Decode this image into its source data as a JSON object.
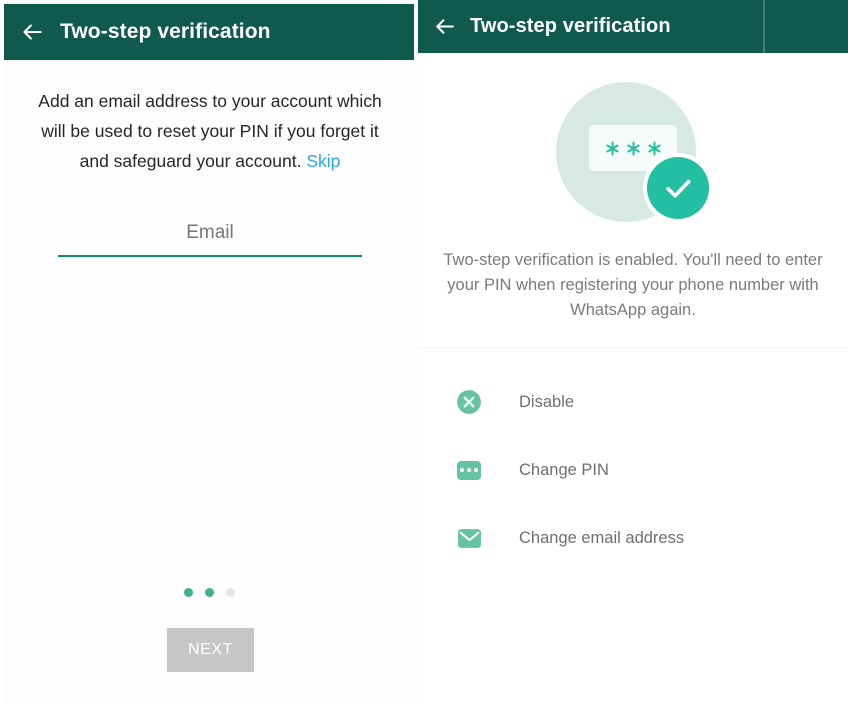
{
  "left_screen": {
    "appbar": {
      "back_icon": "back-arrow-icon",
      "title": "Two-step verification"
    },
    "intro": {
      "text": "Add an email address to your account which will be used to reset your PIN if you forget it and safeguard your account. ",
      "skip_label": "Skip"
    },
    "email_input": {
      "placeholder": "Email",
      "value": ""
    },
    "pager": {
      "total": 3,
      "active_index": 1
    },
    "next_button": {
      "label": "NEXT",
      "enabled": false
    }
  },
  "right_screen": {
    "appbar": {
      "back_icon": "back-arrow-icon",
      "title": "Two-step verification"
    },
    "illustration": {
      "card_symbols": "✱✱✱",
      "badge_icon": "check-circle-icon"
    },
    "description": "Two-step verification is enabled. You'll need to enter your PIN when registering your phone number with WhatsApp again.",
    "actions": [
      {
        "icon": "close-circle-icon",
        "label": "Disable"
      },
      {
        "icon": "pin-dots-icon",
        "label": "Change PIN"
      },
      {
        "icon": "envelope-icon",
        "label": "Change email address"
      }
    ]
  },
  "colors": {
    "appbar_green": "#10594f",
    "accent_green": "#0e8a6c",
    "teal": "#23bfa2",
    "icon_green": "#63c3a4",
    "skip_blue": "#29a8e0",
    "disabled_gray": "#c6c6c6",
    "illustration_bg": "#d7eae1"
  }
}
